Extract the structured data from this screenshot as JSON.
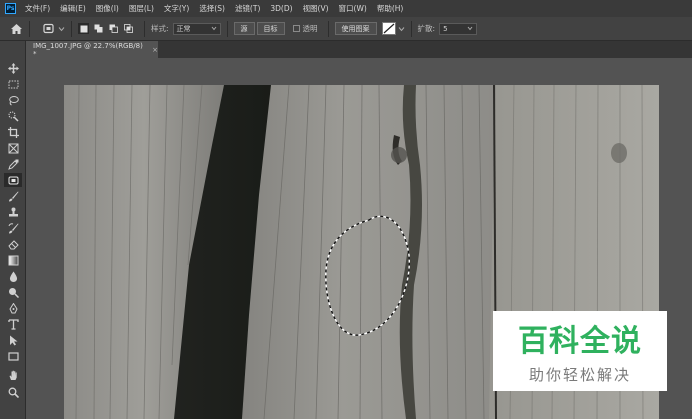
{
  "app": {
    "logo_text": "Ps"
  },
  "menu": [
    "文件(F)",
    "编辑(E)",
    "图像(I)",
    "图层(L)",
    "文字(Y)",
    "选择(S)",
    "滤镜(T)",
    "3D(D)",
    "视图(V)",
    "窗口(W)",
    "帮助(H)"
  ],
  "options": {
    "feather_label": "样式:",
    "style_value": "正常",
    "source_button": "源",
    "target_button": "目标",
    "transparent_label": "透明",
    "use_pattern_button": "使用图案",
    "diffusion_label": "扩散:",
    "diffusion_value": "5"
  },
  "document": {
    "tab_title": "IMG_1007.JPG @ 22.7%(RGB/8) *",
    "close_symbol": "×"
  },
  "watermark": {
    "title": "百科全说",
    "subtitle": "助你轻松解决",
    "color": "#2fb15e"
  },
  "tools": [
    "move-icon",
    "marquee-icon",
    "lasso-icon",
    "quick-select-icon",
    "crop-icon",
    "frame-icon",
    "eyedropper-icon",
    "patch-icon",
    "brush-icon",
    "stamp-icon",
    "history-brush-icon",
    "eraser-icon",
    "gradient-icon",
    "blur-icon",
    "dodge-icon",
    "pen-icon",
    "type-icon",
    "path-select-icon",
    "rectangle-icon",
    "hand-icon",
    "zoom-icon"
  ]
}
